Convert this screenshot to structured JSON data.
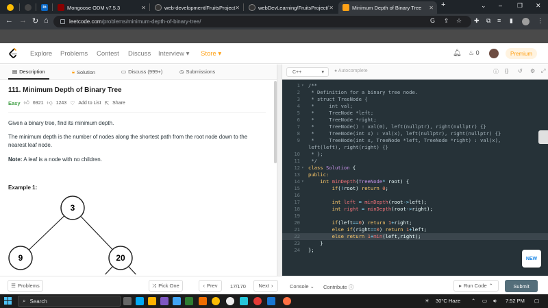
{
  "browser": {
    "tabs": [
      {
        "label": "",
        "icon": "chrome-icon"
      },
      {
        "label": "",
        "icon": "linkedin-icon"
      },
      {
        "label": "Mongoose ODM v7.5.3",
        "icon": "mongoose-icon"
      },
      {
        "label": "web-development/FruitsProject",
        "icon": "github-icon"
      },
      {
        "label": "webDevLearning/FruitsProject/",
        "icon": "github-icon"
      },
      {
        "label": "Minimum Depth of Binary Tree",
        "icon": "leetcode-icon"
      }
    ],
    "url_host": "leetcode.com",
    "url_path": "/problems/minimum-depth-of-binary-tree/"
  },
  "header": {
    "nav": [
      "Explore",
      "Problems",
      "Contest",
      "Discuss",
      "Interview ▾",
      "Store ▾"
    ],
    "streak_count": "0",
    "premium_label": "Premium"
  },
  "panel_tabs": [
    "Description",
    "Solution",
    "Discuss (999+)",
    "Submissions"
  ],
  "problem": {
    "title": "111. Minimum Depth of Binary Tree",
    "difficulty": "Easy",
    "likes": "6921",
    "dislikes": "1243",
    "add_to_list": "Add to List",
    "share": "Share",
    "p1": "Given a binary tree, find its minimum depth.",
    "p2": "The minimum depth is the number of nodes along the shortest path from the root node down to the nearest leaf node.",
    "note_label": "Note:",
    "note_text": " A leaf is a node with no children.",
    "example_title": "Example 1:",
    "tree_nodes": [
      "3",
      "9",
      "20"
    ]
  },
  "editor": {
    "language": "C++",
    "autocomplete": "Autocomplete",
    "new_badge": "NEW",
    "lines": [
      {
        "n": "1",
        "fold": "▾",
        "code": [
          [
            "c-cm",
            "/**"
          ]
        ]
      },
      {
        "n": "2",
        "fold": "",
        "code": [
          [
            "c-cm",
            " * Definition for a binary tree node."
          ]
        ]
      },
      {
        "n": "3",
        "fold": "",
        "code": [
          [
            "c-cm",
            " * struct TreeNode {"
          ]
        ]
      },
      {
        "n": "4",
        "fold": "",
        "code": [
          [
            "c-cm",
            " *     int val;"
          ]
        ]
      },
      {
        "n": "5",
        "fold": "",
        "code": [
          [
            "c-cm",
            " *     TreeNode *left;"
          ]
        ]
      },
      {
        "n": "6",
        "fold": "",
        "code": [
          [
            "c-cm",
            " *     TreeNode *right;"
          ]
        ]
      },
      {
        "n": "7",
        "fold": "",
        "code": [
          [
            "c-cm",
            " *     TreeNode() : val(0), left(nullptr), right(nullptr) {}"
          ]
        ]
      },
      {
        "n": "8",
        "fold": "",
        "code": [
          [
            "c-cm",
            " *     TreeNode(int x) : val(x), left(nullptr), right(nullptr) {}"
          ]
        ]
      },
      {
        "n": "9",
        "fold": "",
        "code": [
          [
            "c-cm",
            " *     TreeNode(int x, TreeNode *left, TreeNode *right) : val(x),"
          ]
        ]
      },
      {
        "n": "",
        "fold": "",
        "code": [
          [
            "c-cm",
            "left(left), right(right) {}"
          ]
        ]
      },
      {
        "n": "10",
        "fold": "",
        "code": [
          [
            "c-cm",
            " * };"
          ]
        ]
      },
      {
        "n": "11",
        "fold": "",
        "code": [
          [
            "c-cm",
            " */"
          ]
        ]
      },
      {
        "n": "12",
        "fold": "▾",
        "code": [
          [
            "c-kw",
            "class "
          ],
          [
            "c-ty",
            "Solution"
          ],
          [
            "",
            " {"
          ]
        ]
      },
      {
        "n": "13",
        "fold": "",
        "code": [
          [
            "c-kw",
            "public:"
          ]
        ]
      },
      {
        "n": "14",
        "fold": "▾",
        "code": [
          [
            "",
            "    "
          ],
          [
            "c-kw",
            "int "
          ],
          [
            "c-fn",
            "minDepth"
          ],
          [
            "",
            "("
          ],
          [
            "c-ty",
            "TreeNode"
          ],
          [
            "c-op",
            "*"
          ],
          [
            "",
            " root) {"
          ]
        ]
      },
      {
        "n": "15",
        "fold": "",
        "code": [
          [
            "",
            "        "
          ],
          [
            "c-kw",
            "if"
          ],
          [
            "",
            "("
          ],
          [
            "c-op",
            "!"
          ],
          [
            "",
            "root) "
          ],
          [
            "c-kw",
            "return "
          ],
          [
            "c-nm",
            "0"
          ],
          [
            "",
            ";"
          ]
        ]
      },
      {
        "n": "16",
        "fold": "",
        "code": [
          [
            "",
            ""
          ]
        ]
      },
      {
        "n": "17",
        "fold": "",
        "code": [
          [
            "",
            "        "
          ],
          [
            "c-kw",
            "int "
          ],
          [
            "c-fn",
            "left"
          ],
          [
            "",
            " "
          ],
          [
            "c-op",
            "="
          ],
          [
            "",
            " "
          ],
          [
            "c-fn",
            "minDepth"
          ],
          [
            "",
            "(root"
          ],
          [
            "c-op",
            "->"
          ],
          [
            "",
            "left);"
          ]
        ]
      },
      {
        "n": "18",
        "fold": "",
        "code": [
          [
            "",
            "        "
          ],
          [
            "c-kw",
            "int "
          ],
          [
            "c-fn",
            "right"
          ],
          [
            "",
            " "
          ],
          [
            "c-op",
            "="
          ],
          [
            "",
            " "
          ],
          [
            "c-fn",
            "minDepth"
          ],
          [
            "",
            "(root"
          ],
          [
            "c-op",
            "->"
          ],
          [
            "",
            "right);"
          ]
        ]
      },
      {
        "n": "19",
        "fold": "",
        "code": [
          [
            "",
            ""
          ]
        ]
      },
      {
        "n": "20",
        "fold": "",
        "code": [
          [
            "",
            "        "
          ],
          [
            "c-kw",
            "if"
          ],
          [
            "",
            "(left"
          ],
          [
            "c-op",
            "=="
          ],
          [
            "c-nm",
            "0"
          ],
          [
            "",
            ") "
          ],
          [
            "c-kw",
            "return "
          ],
          [
            "c-nm",
            "1"
          ],
          [
            "c-op",
            "+"
          ],
          [
            "",
            "right;"
          ]
        ]
      },
      {
        "n": "21",
        "fold": "",
        "code": [
          [
            "",
            "        "
          ],
          [
            "c-kw",
            "else if"
          ],
          [
            "",
            "(right"
          ],
          [
            "c-op",
            "=="
          ],
          [
            "c-nm",
            "0"
          ],
          [
            "",
            ") "
          ],
          [
            "c-kw",
            "return "
          ],
          [
            "c-nm",
            "1"
          ],
          [
            "c-op",
            "+"
          ],
          [
            "",
            "left;"
          ]
        ]
      },
      {
        "n": "22",
        "fold": "",
        "code": [
          [
            "",
            "        "
          ],
          [
            "c-kw",
            "else return "
          ],
          [
            "c-nm",
            "1"
          ],
          [
            "c-op",
            "+"
          ],
          [
            "c-fn",
            "min"
          ],
          [
            "",
            "(left,right);"
          ]
        ]
      },
      {
        "n": "23",
        "fold": "",
        "code": [
          [
            "",
            "    }"
          ]
        ]
      },
      {
        "n": "24",
        "fold": "",
        "code": [
          [
            "",
            "};"
          ]
        ]
      }
    ],
    "highlight_line": "22"
  },
  "footer": {
    "problems": "Problems",
    "pick_one": "Pick One",
    "prev": "Prev",
    "counter": "17/170",
    "next": "Next",
    "console": "Console",
    "contribute": "Contribute",
    "run_code": "Run Code",
    "submit": "Submit"
  },
  "taskbar": {
    "search": "Search",
    "weather": "30°C  Haze",
    "time": "7:52 PM"
  },
  "colors": {
    "accent": "#ffa116",
    "easy": "#43a047",
    "editor_bg": "#263238",
    "submit_bg": "#546e7a"
  }
}
